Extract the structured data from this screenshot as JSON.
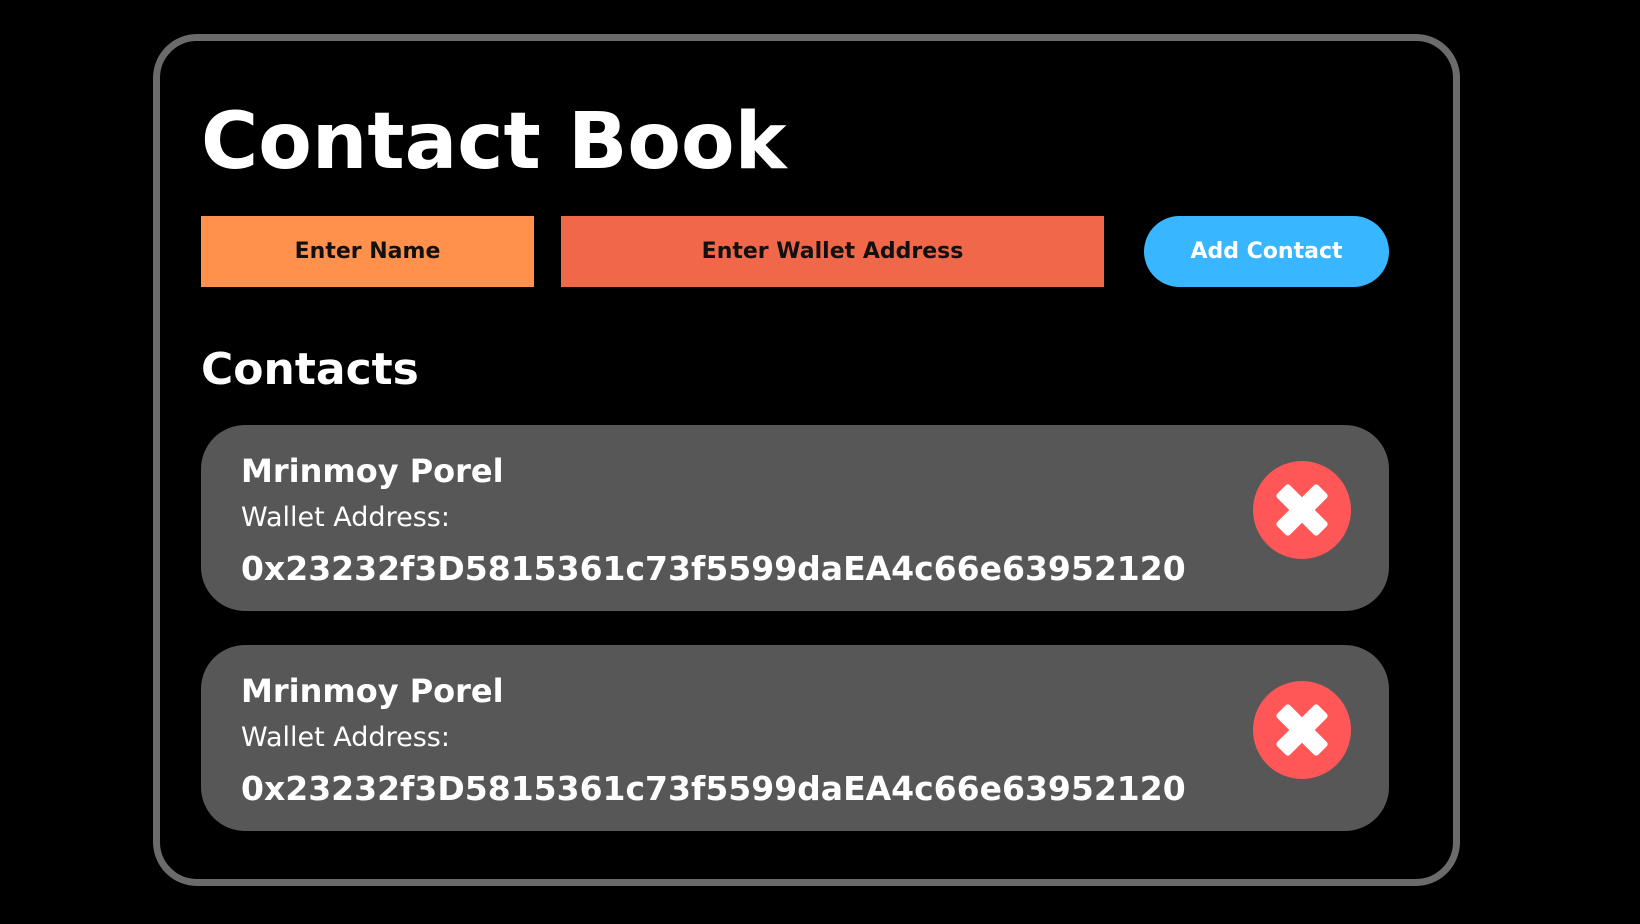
{
  "header": {
    "title": "Contact Book"
  },
  "form": {
    "name_placeholder": "Enter Name",
    "wallet_placeholder": "Enter Wallet Address",
    "add_button_label": "Add Contact"
  },
  "contacts_section": {
    "title": "Contacts",
    "items": [
      {
        "name": "Mrinmoy Porel",
        "wallet_label": "Wallet Address:",
        "wallet_address": "0x23232f3D5815361c73f5599daEA4c66e63952120",
        "delete_icon": "close-x-icon"
      },
      {
        "name": "Mrinmoy Porel",
        "wallet_label": "Wallet Address:",
        "wallet_address": "0x23232f3D5815361c73f5599daEA4c66e63952120",
        "delete_icon": "close-x-icon"
      }
    ]
  },
  "colors": {
    "background": "#000000",
    "frame_border": "#6b6b6b",
    "name_input": "#ff914d",
    "wallet_input": "#f0674a",
    "add_button": "#38b6ff",
    "card": "#575757",
    "delete_button": "#ff5757"
  }
}
